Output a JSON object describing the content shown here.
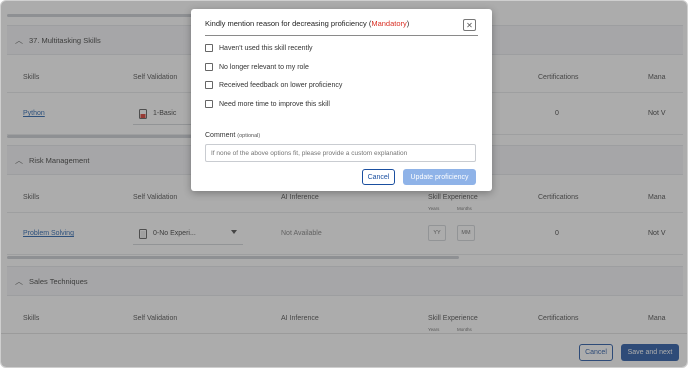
{
  "sections": [
    {
      "title": "37. Multitasking Skills",
      "columns": [
        "Skills",
        "Self Validation",
        "Certifications",
        "Mana"
      ],
      "row": {
        "skill": "Python",
        "self_validation": "1-Basic",
        "certifications": "0",
        "mana": "Not V"
      }
    },
    {
      "title": "Risk Management",
      "columns": [
        "Skills",
        "Self Validation",
        "AI Inference",
        "Skill Experience",
        "Certifications",
        "Mana"
      ],
      "exp_sub": [
        "Years",
        "Months"
      ],
      "row": {
        "skill": "Problem Solving",
        "self_validation": "0-No Experi...",
        "ai_inference": "Not Available",
        "years": "YY",
        "months": "MM",
        "certifications": "0",
        "mana": "Not V"
      }
    },
    {
      "title": "Sales Techniques",
      "columns": [
        "Skills",
        "Self Validation",
        "AI Inference",
        "Skill Experience",
        "Certifications",
        "Mana"
      ],
      "exp_sub": [
        "Years",
        "Months"
      ]
    }
  ],
  "footer": {
    "cancel": "Cancel",
    "save_next": "Save and next"
  },
  "modal": {
    "title": "Kindly mention reason for decreasing proficiency (",
    "mandatory": "Mandatory",
    "title_close_paren": ")",
    "close": "✕",
    "options": [
      "Haven't used this skill recently",
      "No longer relevant to my role",
      "Received feedback on lower proficiency",
      "Need more time to improve this skill"
    ],
    "comment_label": "Comment",
    "comment_optional": "(optional)",
    "comment_placeholder": "If none of the above options fit, please provide a custom explanation",
    "cancel": "Cancel",
    "update": "Update proficiency"
  },
  "colors": {
    "primary": "#1a4fa0",
    "primary_disabled": "#8fb3e8",
    "link": "#1a5aa8",
    "mandatory": "#d93025"
  }
}
